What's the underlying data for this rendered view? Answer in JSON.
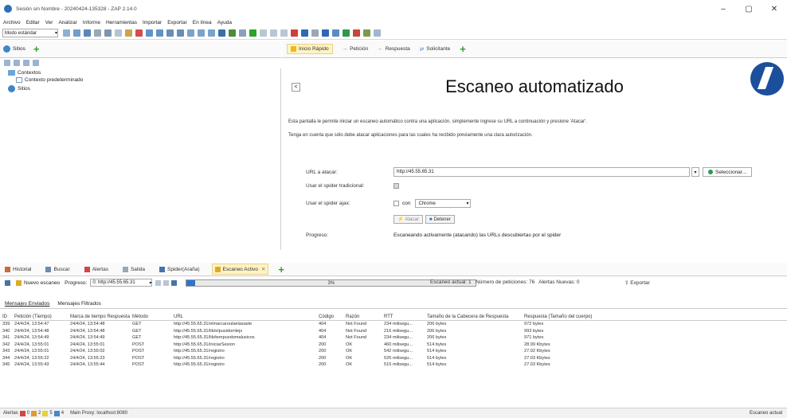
{
  "window": {
    "title": "Sesión sin Nombre - 20240424-135328 - ZAP 2.14.0",
    "minimize": "–",
    "maximize": "▢",
    "close": "✕"
  },
  "menu": [
    "Archivo",
    "Editar",
    "Ver",
    "Analizar",
    "Informe",
    "Herramientas",
    "Importar",
    "Exportar",
    "En línea",
    "Ayuda"
  ],
  "toolbar": {
    "mode_label": "Modo estándar"
  },
  "left_panel": {
    "tab_label": "Sitios",
    "tree": {
      "contexts": "Contextos",
      "default_context": "Contexto predeterminado",
      "sites": "Sitios"
    }
  },
  "right_tabs": [
    "Inicio Rápido",
    "Petición",
    "Respuesta",
    "Solicitante"
  ],
  "quick_start": {
    "title": "Escaneo automatizado",
    "back": "<",
    "desc1": "Esta pantalla le permite iniciar un escaneo automático contra una aplicación, simplemente ingrese su URL a continuación y presione 'Atacar'.",
    "desc2": "Tenga en cuenta que sólo debe atacar aplicaciones para las cuales ha recibido previamente una clara autorización.",
    "url_label": "URL a atacar:",
    "url_value": "http://45.55.65.31",
    "select_button": "Seleccionar...",
    "traditional_spider_label": "Usar el spider tradicional:",
    "ajax_spider_label": "Usar el spider ajax:",
    "ajax_with": "con",
    "browser": "Chrome",
    "attack_button": "Atacar",
    "stop_button": "Detener",
    "progress_label": "Progreso:",
    "progress_value": "Escaneando activamente (atacando) las URLs descubiertas por el spider"
  },
  "bottom_tabs": [
    "Historial",
    "Buscar",
    "Alertas",
    "Salida",
    "Spider(Araña)",
    "Escaneo Activo"
  ],
  "active_scan": {
    "new_scan": "Nuevo escaneo",
    "progress_label": "Progreso:",
    "progress_target": "0: http://45.55.65.31",
    "progress_percent": 0.03,
    "progress_text": "3%",
    "current_scans": "Escaneo actual: 1",
    "requests": "Número de peticiones: 76",
    "new_alerts": "Alertas Nuevas: 0",
    "export": "Exportar"
  },
  "sub_tabs": [
    "Mensajes Enviados",
    "Mensajes Filtrados"
  ],
  "table": {
    "headers": [
      "ID",
      "Petición (Tiempo)",
      "Marca de tiempo Respuesta",
      "Método",
      "URL",
      "Código",
      "Razón",
      "RTT",
      "Tamaño de la Cabecera de Respuesta",
      "Respuesta (Tamaño del cuerpo)"
    ],
    "rows": [
      [
        "339",
        "24/4/24, 13:54:47",
        "24/4/24, 13:54:48",
        "GET",
        "http://45.55.65.31/elmarcaroulaelasaste",
        "404",
        "Not Found",
        "234 milisegu...",
        "206 bytes",
        "972 bytes"
      ],
      [
        "340",
        "24/4/24, 13:54:48",
        "24/4/24, 13:54:48",
        "GET",
        "http://45.55.65.31/lib/elpusidomlejs",
        "404",
        "Not Found",
        "216 milisegu...",
        "206 bytes",
        "993 bytes"
      ],
      [
        "341",
        "24/4/24, 13:54:49",
        "24/4/24, 13:54:49",
        "GET",
        "http://45.55.65.31/lib/tempusdomalusicos",
        "404",
        "Not Found",
        "234 milisegu...",
        "206 bytes",
        "971 bytes"
      ],
      [
        "342",
        "24/4/24, 13:55:01",
        "24/4/24, 13:55:01",
        "POST",
        "http://45.55.65.31/iniciarSesion",
        "200",
        "OK",
        "460 milisegu...",
        "514 bytes",
        "28.99 Kbytes"
      ],
      [
        "343",
        "24/4/24, 13:55:01",
        "24/4/24, 13:55:02",
        "POST",
        "http://45.55.65.31/registro",
        "200",
        "OK",
        "542 milisegu...",
        "514 bytes",
        "27.02 Kbytes"
      ],
      [
        "344",
        "24/4/24, 13:55:22",
        "24/4/24, 13:55:23",
        "POST",
        "http://45.55.65.31/registro",
        "200",
        "OK",
        "526 milisegu...",
        "514 bytes",
        "27.03 Kbytes"
      ],
      [
        "345",
        "24/4/24, 13:55:43",
        "24/4/24, 13:55:44",
        "POST",
        "http://45.55.65.31/registro",
        "200",
        "OK",
        "516 milisegu...",
        "514 bytes",
        "27.03 Kbytes"
      ]
    ]
  },
  "status": {
    "alerts_label": "Alertas",
    "a1": "0",
    "a2": "2",
    "a3": "5",
    "a4": "4",
    "proxy": "Main Proxy: localhost:8080",
    "right": "Escaneo actual"
  },
  "colors": {
    "accent": "#2f74d0",
    "active_tab": "#fff3c4",
    "zap_blue": "#1b4f9c"
  }
}
